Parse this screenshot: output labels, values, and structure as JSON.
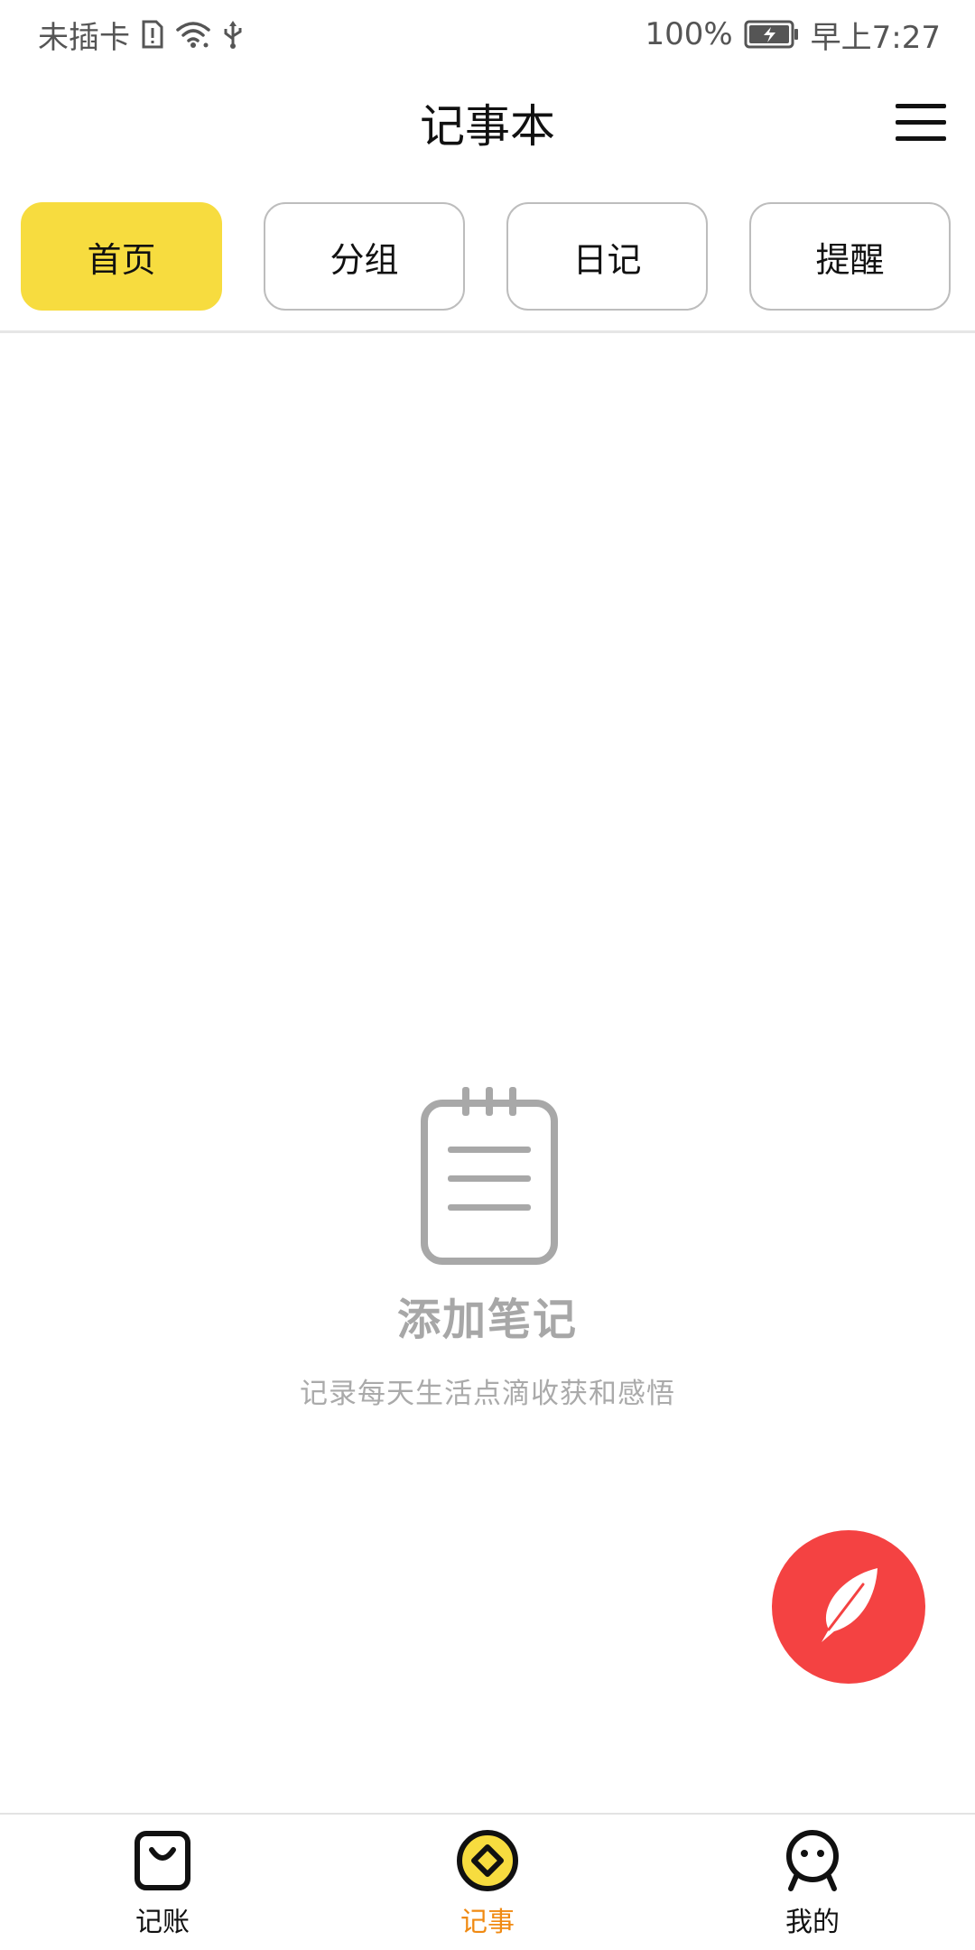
{
  "status_bar": {
    "carrier": "未插卡",
    "battery": "100%",
    "time": "早上7:27"
  },
  "header": {
    "title": "记事本",
    "menu_icon": "hamburger-menu-icon"
  },
  "tabs": [
    {
      "label": "首页",
      "active": true
    },
    {
      "label": "分组",
      "active": false
    },
    {
      "label": "日记",
      "active": false
    },
    {
      "label": "提醒",
      "active": false
    }
  ],
  "empty_state": {
    "icon": "notepad-icon",
    "title": "添加笔记",
    "subtitle": "记录每天生活点滴收获和感悟"
  },
  "fab": {
    "icon": "feather-icon"
  },
  "bottom_nav": [
    {
      "label": "记账",
      "icon": "shopping-bag-icon",
      "active": false
    },
    {
      "label": "记事",
      "icon": "diamond-coin-icon",
      "active": true
    },
    {
      "label": "我的",
      "icon": "person-face-icon",
      "active": false
    }
  ],
  "colors": {
    "tab_active": "#f7dc3f",
    "fab": "#f44242",
    "nav_active_label": "#f08a12",
    "empty_text": "#a7a7a7"
  }
}
